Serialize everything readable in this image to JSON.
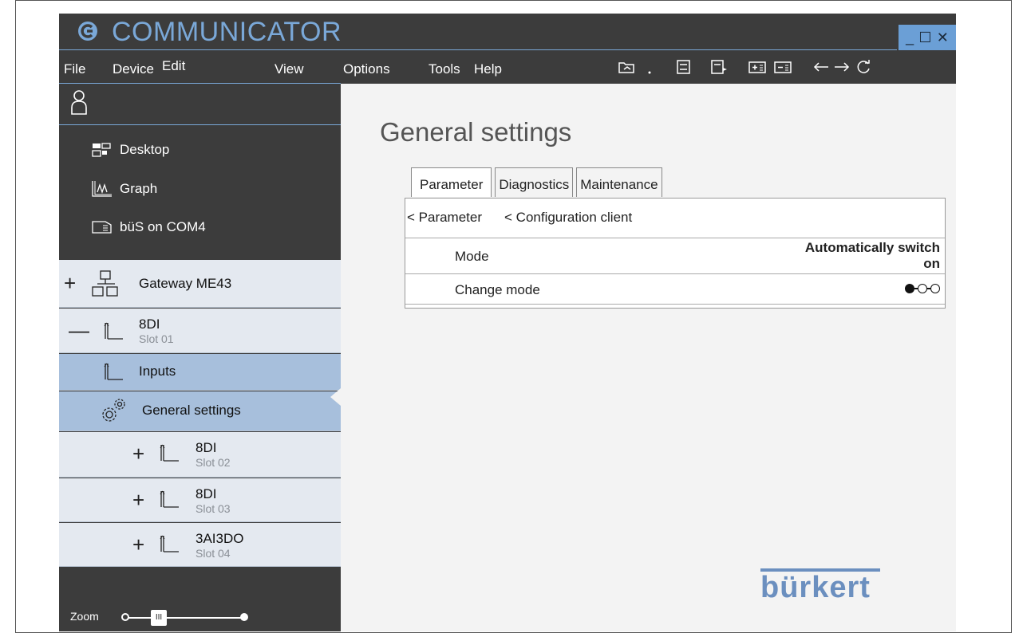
{
  "app": {
    "title": "COMMUNICATOR",
    "window_controls": {
      "minimize": "_",
      "maximize": "☐",
      "close": "✕"
    }
  },
  "menu": {
    "items": [
      "File",
      "Device",
      "Edit",
      "View",
      "Options",
      "Tools",
      "Help"
    ]
  },
  "toolbar": {
    "icons": [
      "open-icon",
      "save-icon",
      "save-as-icon",
      "add-device-icon",
      "remove-device-icon",
      "back-arrow-icon",
      "forward-arrow-icon",
      "refresh-icon"
    ]
  },
  "sidebar": {
    "links": [
      {
        "label": "Desktop",
        "icon": "desktop-icon"
      },
      {
        "label": "Graph",
        "icon": "graph-icon"
      },
      {
        "label": "büS on COM4",
        "icon": "bus-icon"
      }
    ],
    "tree": [
      {
        "sign": "+",
        "label": "Gateway ME43",
        "sub": ""
      },
      {
        "sign": "—",
        "label": "8DI",
        "sub": "Slot 01"
      },
      {
        "sign": "",
        "label": "Inputs",
        "sub": ""
      },
      {
        "sign": "",
        "label": "General settings",
        "sub": ""
      },
      {
        "sign": "+",
        "label": "8DI",
        "sub": "Slot 02"
      },
      {
        "sign": "+",
        "label": "8DI",
        "sub": "Slot 03"
      },
      {
        "sign": "+",
        "label": "3AI3DO",
        "sub": "Slot 04"
      }
    ],
    "zoom": {
      "label": "Zoom",
      "thumb": "III",
      "level": 0.3
    }
  },
  "main": {
    "title": "General settings",
    "tabs": [
      "Parameter",
      "Diagnostics",
      "Maintenance"
    ],
    "selected_tab": "Parameter",
    "breadcrumbs": [
      "< Parameter",
      "< Configuration client"
    ],
    "rows": [
      {
        "label": "Mode",
        "value_line1": "Automatically switch",
        "value_line2": "on"
      },
      {
        "label": "Change mode",
        "selected_index": 0,
        "options_count": 3
      }
    ]
  },
  "brand": {
    "name": "bürkert"
  },
  "colors": {
    "accent": "#7aa8d8",
    "sidebar": "#3c3c3c",
    "tree_bg": "#e4e9f0",
    "tree_active": "#a7bfdc",
    "brand": "#6b8fbf"
  }
}
